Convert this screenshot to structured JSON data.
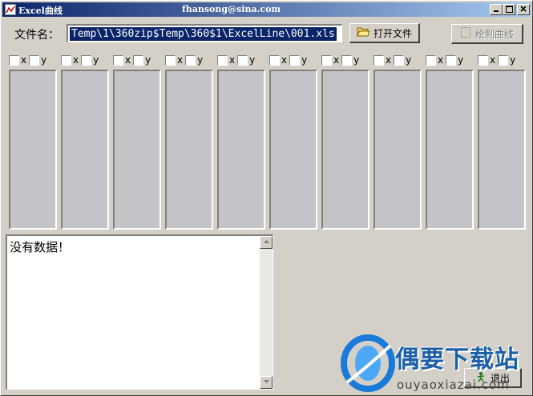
{
  "window": {
    "title": "Excel曲线",
    "email": "fhansong@sina.com"
  },
  "file": {
    "label": "文件名：",
    "path": "Temp\\1\\360zip$Temp\\360$1\\ExcelLine\\001.xls"
  },
  "buttons": {
    "open_label": "打开文件",
    "draw_label": "绘制曲线",
    "exit_label": "退出"
  },
  "channels": [
    {
      "x_label": "x",
      "y_label": "y"
    },
    {
      "x_label": "x",
      "y_label": "y"
    },
    {
      "x_label": "x",
      "y_label": "y"
    },
    {
      "x_label": "x",
      "y_label": "y"
    },
    {
      "x_label": "x",
      "y_label": "y"
    },
    {
      "x_label": "x",
      "y_label": "y"
    },
    {
      "x_label": "x",
      "y_label": "y"
    },
    {
      "x_label": "x",
      "y_label": "y"
    },
    {
      "x_label": "x",
      "y_label": "y"
    },
    {
      "x_label": "x",
      "y_label": "y"
    }
  ],
  "message": {
    "text": "没有数据！"
  },
  "watermark": {
    "title": "偶要下载站",
    "url": "ouyaoxiazai.com"
  },
  "icons": {
    "app": "chart-icon",
    "open": "folder-icon",
    "draw": "document-icon",
    "exit": "exit-icon"
  }
}
